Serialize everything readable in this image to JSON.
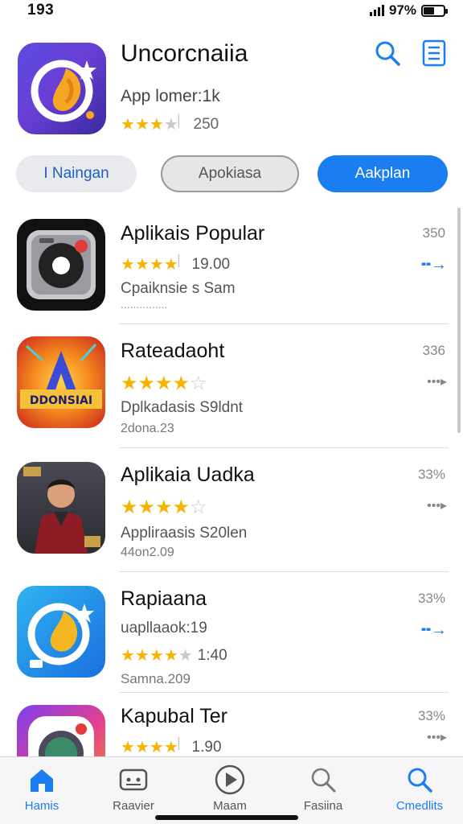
{
  "status_bar": {
    "time": "193",
    "battery": "97%"
  },
  "header": {
    "title": "Uncorcnaiia",
    "subtitle": "App lomer:1k",
    "rating_count": "250",
    "stars": 3.5,
    "search_icon": "search-icon",
    "menu_icon": "list-icon"
  },
  "segments": [
    {
      "label": "I Naingan"
    },
    {
      "label": "Apokiasa"
    },
    {
      "label": "Aakplan"
    }
  ],
  "apps": [
    {
      "name": "Aplikais Popular",
      "rating_text": "19.00",
      "stars": 4.5,
      "line2": "Cpaiknsie s Sam",
      "line3": "...............",
      "size": "350",
      "action": "arrow",
      "accent": "#1a7df0"
    },
    {
      "name": "Rateadaoht",
      "rating_text": "",
      "stars": 4,
      "line2": "Dplkadasis S9ldnt",
      "line3": "2dona.23",
      "size": "336",
      "action": "chevrons",
      "accent": "#888888"
    },
    {
      "name": "Aplikaia Uadka",
      "rating_text": "",
      "stars": 4.5,
      "line2": "Appliraasis S20len",
      "line3": "44on2.09",
      "size": "33%",
      "action": "chevrons",
      "accent": "#888888"
    },
    {
      "name": "Rapiaana",
      "rating_text": "1:40",
      "stars": 4.5,
      "line2": "uapllaaok:19",
      "line3": "Samna.209",
      "size": "33%",
      "action": "arrow",
      "accent": "#1a7df0"
    },
    {
      "name": "Kapubal Ter",
      "rating_text": "1.90",
      "stars": 4.5,
      "line2": "",
      "line3": "",
      "size": "33%",
      "action": "chevrons",
      "accent": "#888888"
    }
  ],
  "tabs": [
    {
      "label": "Hamis",
      "icon": "home-icon",
      "active": true
    },
    {
      "label": "Raavier",
      "icon": "game-icon",
      "active": false
    },
    {
      "label": "Maam",
      "icon": "play-icon",
      "active": false
    },
    {
      "label": "Fasiina",
      "icon": "search-icon",
      "active": false
    },
    {
      "label": "Cmedlits",
      "icon": "search-icon",
      "active": true
    }
  ],
  "colors": {
    "accent": "#1a7df0",
    "star": "#f4b400"
  }
}
